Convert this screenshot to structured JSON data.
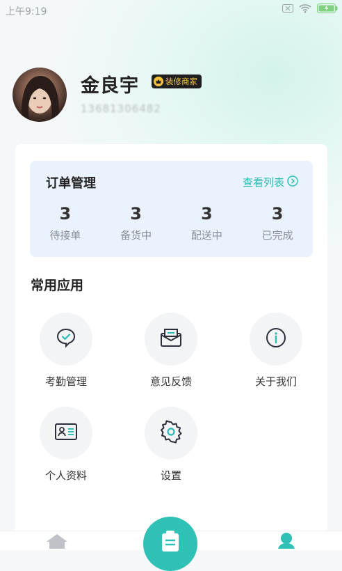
{
  "status_bar": {
    "time": "上午9:19"
  },
  "profile": {
    "name": "金良宇",
    "badge": "装修商家",
    "phone": "13681306482"
  },
  "orders": {
    "title": "订单管理",
    "link": "查看列表",
    "stats": [
      {
        "value": "3",
        "label": "待接单"
      },
      {
        "value": "3",
        "label": "备货中"
      },
      {
        "value": "3",
        "label": "配送中"
      },
      {
        "value": "3",
        "label": "已完成"
      }
    ]
  },
  "apps": {
    "title": "常用应用",
    "items": [
      {
        "label": "考勤管理",
        "icon": "check-chat-icon"
      },
      {
        "label": "意见反馈",
        "icon": "envelope-icon"
      },
      {
        "label": "关于我们",
        "icon": "info-icon"
      },
      {
        "label": "个人资料",
        "icon": "id-card-icon"
      },
      {
        "label": "设置",
        "icon": "gear-icon"
      }
    ]
  },
  "colors": {
    "accent": "#2bbcb6",
    "badge_bg": "#1f1f1f",
    "badge_text": "#f4c23a"
  }
}
